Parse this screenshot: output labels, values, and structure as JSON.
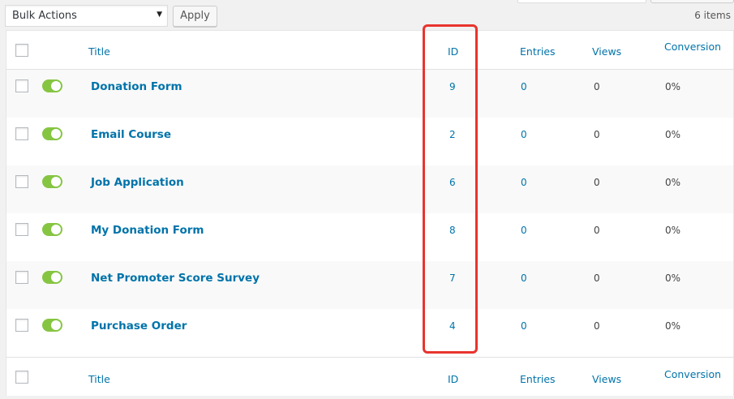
{
  "bulk_actions": {
    "selected": "Bulk Actions",
    "apply_label": "Apply"
  },
  "items_count": "6 items",
  "columns": {
    "title": "Title",
    "id": "ID",
    "entries": "Entries",
    "views": "Views",
    "conversion": "Conversion"
  },
  "rows": [
    {
      "title": "Donation Form",
      "id": "9",
      "entries": "0",
      "views": "0",
      "conversion": "0%",
      "enabled": true
    },
    {
      "title": "Email Course",
      "id": "2",
      "entries": "0",
      "views": "0",
      "conversion": "0%",
      "enabled": true
    },
    {
      "title": "Job Application",
      "id": "6",
      "entries": "0",
      "views": "0",
      "conversion": "0%",
      "enabled": true
    },
    {
      "title": "My Donation Form",
      "id": "8",
      "entries": "0",
      "views": "0",
      "conversion": "0%",
      "enabled": true
    },
    {
      "title": "Net Promoter Score Survey",
      "id": "7",
      "entries": "0",
      "views": "0",
      "conversion": "0%",
      "enabled": true
    },
    {
      "title": "Purchase Order",
      "id": "4",
      "entries": "0",
      "views": "0",
      "conversion": "0%",
      "enabled": true
    }
  ],
  "colors": {
    "link": "#0073aa",
    "toggle_on": "#86c542",
    "highlight": "#e8342e"
  }
}
